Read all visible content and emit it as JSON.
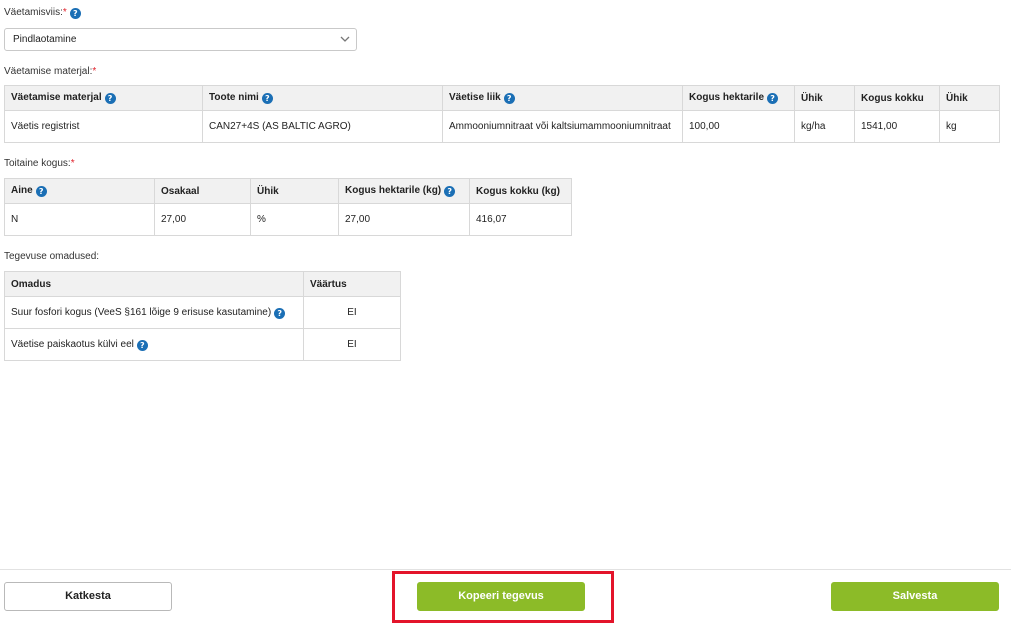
{
  "method": {
    "label": "Väetamisviis:",
    "required_mark": "*",
    "selected_value": "Pindlaotamine"
  },
  "material": {
    "label": "Väetamise materjal:",
    "required_mark": "*",
    "columns": [
      "Väetamise materjal",
      "Toote nimi",
      "Väetise liik",
      "Kogus hektarile",
      "Ühik",
      "Kogus kokku",
      "Ühik"
    ],
    "row": [
      "Väetis registrist",
      "CAN27+4S (AS BALTIC AGRO)",
      "Ammooniumnitraat või kaltsiumammooniumnitraat",
      "100,00",
      "kg/ha",
      "1541,00",
      "kg"
    ]
  },
  "nutrients": {
    "label": "Toitaine kogus:",
    "required_mark": "*",
    "columns": [
      "Aine",
      "Osakaal",
      "Ühik",
      "Kogus hektarile (kg)",
      "Kogus kokku (kg)"
    ],
    "row": [
      "N",
      "27,00",
      "%",
      "27,00",
      "416,07"
    ]
  },
  "properties": {
    "label": "Tegevuse omadused:",
    "columns": [
      "Omadus",
      "Väärtus"
    ],
    "rows": [
      {
        "name": "Suur fosfori kogus (VeeS §161 lõige 9 erisuse kasutamine)",
        "value": "EI"
      },
      {
        "name": "Väetise paiskaotus külvi eel",
        "value": "EI"
      }
    ]
  },
  "footer": {
    "cancel_label": "Katkesta",
    "copy_label": "Kopeeri tegevus",
    "save_label": "Salvesta"
  },
  "colors": {
    "accent_green": "#8cbb28",
    "help_blue": "#1b6fb5",
    "required_red": "#e0202a",
    "highlight_red": "#e3142a"
  },
  "icons": {
    "help": "question-circle-icon",
    "dropdown": "chevron-down-icon"
  }
}
